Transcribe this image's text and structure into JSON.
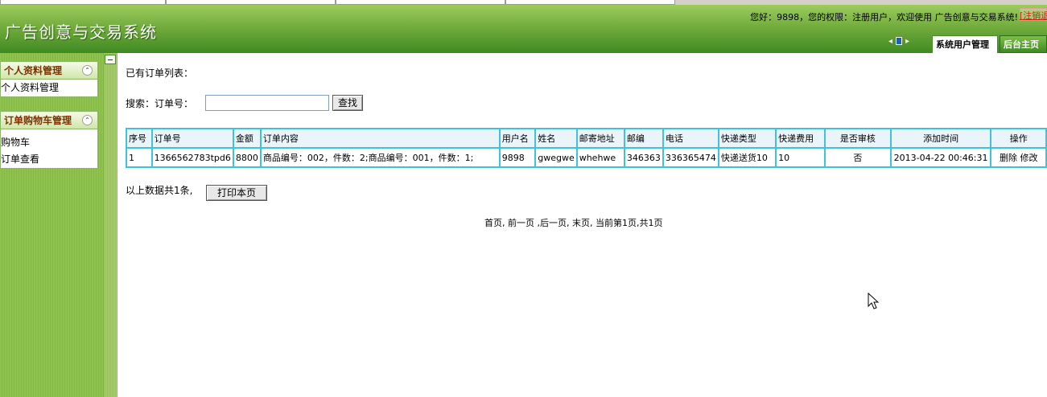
{
  "header": {
    "app_title": "广告创意与交易系统",
    "welcome_text": "您好：9898，您的权限：注册用户，欢迎使用 广告创意与交易系统!",
    "logout_label": "[注销退",
    "tabs": [
      {
        "label": "系统用户管理",
        "active": true
      },
      {
        "label": "后台主页",
        "active": false
      }
    ]
  },
  "sidebar": {
    "panels": [
      {
        "title": "个人资料管理",
        "items": [
          "个人资料管理"
        ]
      },
      {
        "title": "订单购物车管理",
        "items": [
          "购物车",
          "订单查看"
        ]
      }
    ]
  },
  "main": {
    "list_label": "已有订单列表：",
    "search_label": "搜索：订单号：",
    "search_value": "",
    "find_button": "查找",
    "table": {
      "headers": [
        "序号",
        "订单号",
        "金额",
        "订单内容",
        "用户名",
        "姓名",
        "邮寄地址",
        "邮编",
        "电话",
        "快递类型",
        "快递费用",
        "是否审核",
        "添加时间",
        "操作"
      ],
      "rows": [
        {
          "idx": "1",
          "order_no": "1366562783tpd6",
          "amount": "8800",
          "content": "商品编号：002，件数：2;商品编号：001，件数：1;",
          "username": "9898",
          "name": "gwegwe",
          "address": "whehwe",
          "zip": "346363",
          "phone": "336365474",
          "express_type": "快递送货10",
          "express_fee": "10",
          "audited": "否",
          "added_time": "2013-04-22 00:46:31",
          "delete_label": "删除",
          "edit_label": "修改"
        }
      ]
    },
    "total_text": "以上数据共1条,",
    "print_button": "打印本页",
    "pager_text": "首页, 前一页 ,后一页, 末页, 当前第1页,共1页"
  }
}
